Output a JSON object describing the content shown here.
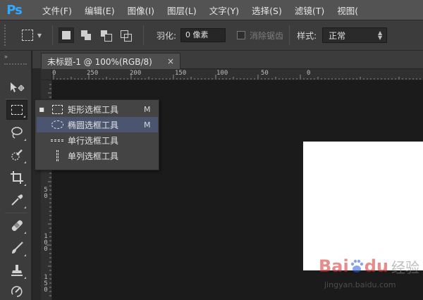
{
  "app": {
    "logo": "Ps"
  },
  "menu": [
    "文件(F)",
    "编辑(E)",
    "图像(I)",
    "图层(L)",
    "文字(Y)",
    "选择(S)",
    "滤镜(T)",
    "视图("
  ],
  "options": {
    "feather_label": "羽化:",
    "feather_value": "0 像素",
    "anti_alias_label": "消除锯齿",
    "style_label": "样式:",
    "style_value": "正常"
  },
  "toolpanel": {
    "collapse_glyph": "»"
  },
  "document": {
    "tab_title": "未标题-1 @ 100%(RGB/8)",
    "tab_close": "×",
    "hruler_labels": [
      "0",
      "250",
      "200",
      "150",
      "100",
      "50",
      "0"
    ],
    "vruler_labels": [
      "5 0",
      "1 0 0",
      "1 5 0"
    ]
  },
  "flyout": {
    "items": [
      {
        "bullet": "■",
        "label": "矩形选框工具",
        "key": "M"
      },
      {
        "bullet": "",
        "label": "椭圆选框工具",
        "key": "M"
      },
      {
        "bullet": "",
        "label": "单行选框工具",
        "key": ""
      },
      {
        "bullet": "",
        "label": "单列选框工具",
        "key": ""
      }
    ]
  },
  "watermark": {
    "brand": "Bai",
    "brand2": "du",
    "suffix": "经验",
    "url": "jingyan.baidu.com"
  },
  "colors": {
    "ps_blue": "#31a8ff",
    "highlight": "#4c5570",
    "baidu_red": "#d32f2f"
  }
}
